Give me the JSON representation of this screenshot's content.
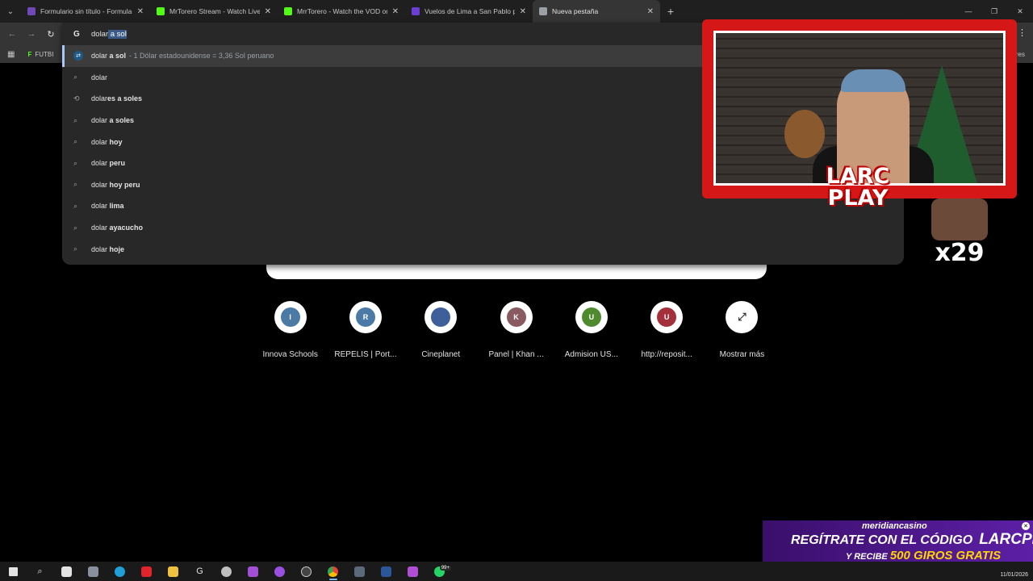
{
  "tabs": [
    {
      "title": "Formulario sin título - Formula",
      "icon": "forms-icon",
      "color": "#7248b9",
      "active": false
    },
    {
      "title": "MrTorero Stream - Watch Live o",
      "icon": "kick-icon",
      "color": "#53fc18",
      "active": false
    },
    {
      "title": "MrrTorero - Watch the VOD on",
      "icon": "kick-icon",
      "color": "#53fc18",
      "active": false
    },
    {
      "title": "Vuelos de Lima a San Pablo por",
      "icon": "flight-icon",
      "color": "#6b3fd4",
      "active": false
    },
    {
      "title": "Nueva pestaña",
      "icon": "chrome-icon",
      "color": "#9aa0a6",
      "active": true
    }
  ],
  "bookmarks": {
    "first": "FUTBI",
    "last": "ores"
  },
  "omnibox": {
    "typed": "dolar",
    "autocomplete": " a sol",
    "suggestions": [
      {
        "icon": "currency-icon",
        "prefix": "dolar",
        "bold": " a sol",
        "desc": " - 1 Dólar estadounidense = 3,36 Sol peruano"
      },
      {
        "icon": "search-icon",
        "prefix": "dolar",
        "bold": "",
        "desc": ""
      },
      {
        "icon": "history-icon",
        "prefix": "dolar",
        "bold": "es a soles",
        "desc": ""
      },
      {
        "icon": "search-icon",
        "prefix": "dolar",
        "bold": " a soles",
        "desc": ""
      },
      {
        "icon": "search-icon",
        "prefix": "dolar",
        "bold": " hoy",
        "desc": ""
      },
      {
        "icon": "search-icon",
        "prefix": "dolar",
        "bold": " peru",
        "desc": ""
      },
      {
        "icon": "search-icon",
        "prefix": "dolar",
        "bold": " hoy peru",
        "desc": ""
      },
      {
        "icon": "search-icon",
        "prefix": "dolar",
        "bold": " lima",
        "desc": ""
      },
      {
        "icon": "search-icon",
        "prefix": "dolar",
        "bold": " ayacucho",
        "desc": ""
      },
      {
        "icon": "search-icon",
        "prefix": "dolar",
        "bold": " hoje",
        "desc": ""
      }
    ]
  },
  "shortcuts": [
    {
      "letter": "I",
      "label": "Innova Schools",
      "color": "#4a7aa5"
    },
    {
      "letter": "R",
      "label": "REPELIS | Port...",
      "color": "#4a7aa5"
    },
    {
      "letter": "",
      "label": "Cineplanet",
      "color": "#3f5f9a"
    },
    {
      "letter": "K",
      "label": "Panel | Khan ...",
      "color": "#8a5a63"
    },
    {
      "letter": "U",
      "label": "Admision US...",
      "color": "#4f8a2f"
    },
    {
      "letter": "U",
      "label": "http://reposit...",
      "color": "#a3303a"
    },
    {
      "letter": "⤢",
      "label": "Mostrar más",
      "color": "#ffffff"
    }
  ],
  "overlay": {
    "logo_line1": "LARC",
    "logo_line2": "PLAY",
    "emote_count": "x29"
  },
  "banner": {
    "brand": "meridiancasino",
    "line1": "REGÍTRATE CON EL CÓDIGO",
    "code": "LARCPLAY",
    "line2": "Y RECIBE",
    "line2_highlight": "500 GIROS GRATIS"
  },
  "taskbar": {
    "badge": "99+",
    "date": "11/01/2026"
  }
}
